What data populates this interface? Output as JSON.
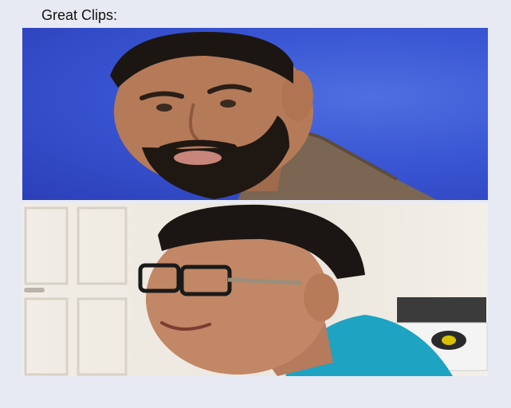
{
  "meme": {
    "caption": "Great Clips:"
  },
  "panels": [
    {
      "subject": "man-with-beard-disapproving"
    },
    {
      "subject": "smiling-boy-with-glasses"
    }
  ]
}
